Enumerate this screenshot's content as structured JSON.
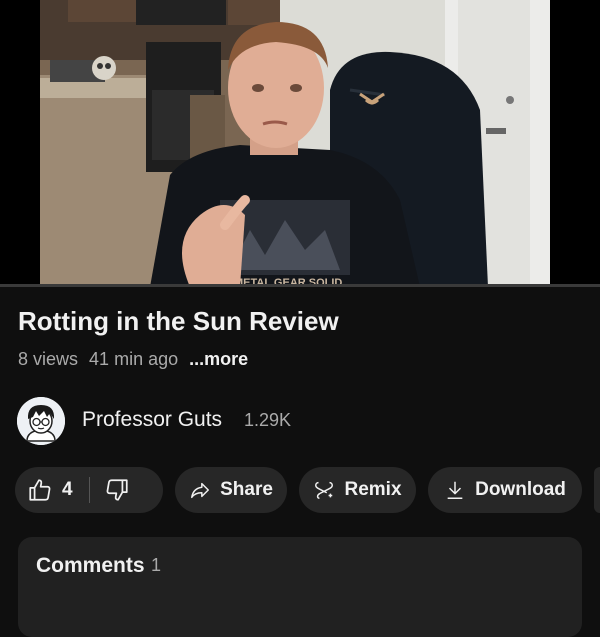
{
  "video": {
    "progress_fraction": 0.0,
    "shirt_text": "METAL GEAR SOLID"
  },
  "title": "Rotting in the Sun Review",
  "meta": {
    "views": "8 views",
    "age": "41 min ago",
    "more": "...more"
  },
  "channel": {
    "name": "Professor Guts",
    "subscribers": "1.29K"
  },
  "actions": {
    "like_count": "4",
    "share": "Share",
    "remix": "Remix",
    "download": "Download"
  },
  "comments": {
    "title": "Comments",
    "count": "1"
  },
  "colors": {
    "background": "#0f0f0f",
    "pill": "#272727",
    "panel": "#212121",
    "secondary_text": "#aaaaaa"
  }
}
